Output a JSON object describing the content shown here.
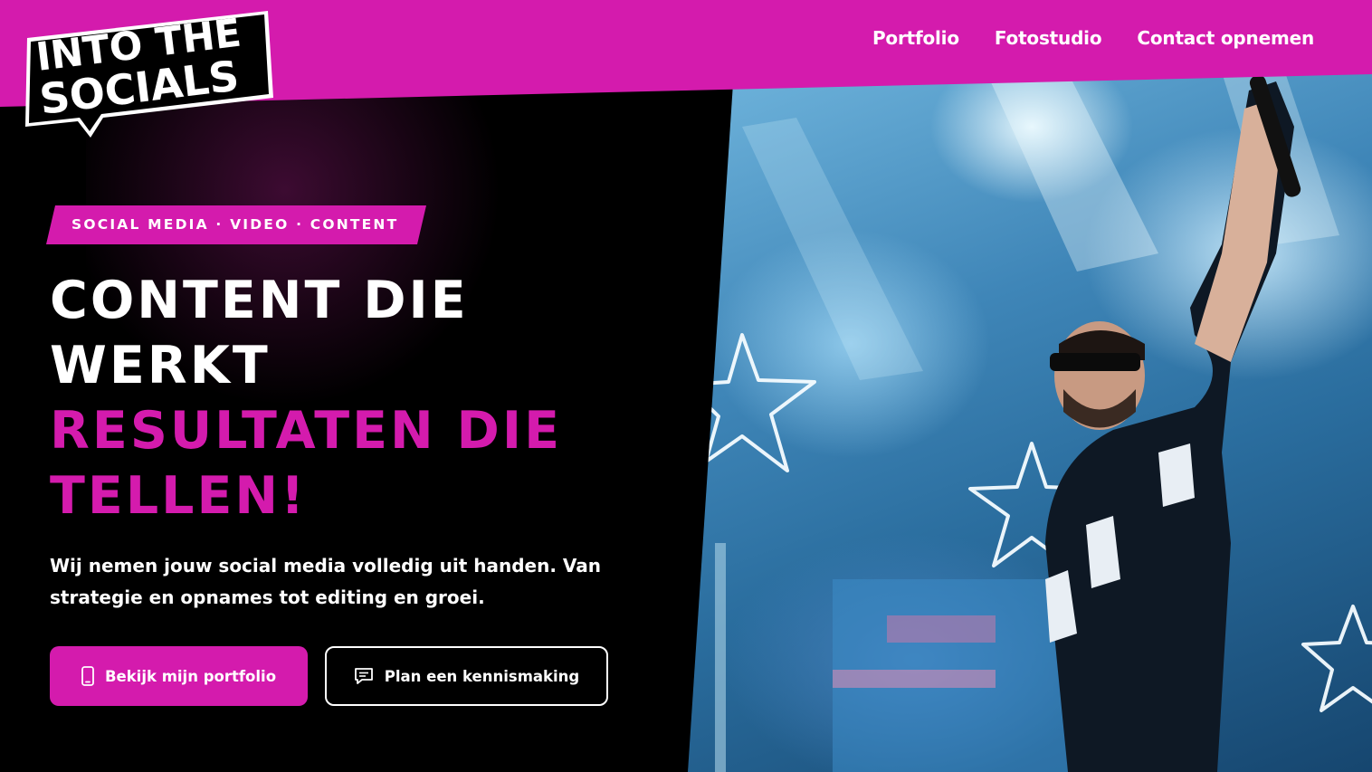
{
  "brand": {
    "logo_line1": "INTO THE",
    "logo_line2": "SOCIALS",
    "accent_color": "#d41bad"
  },
  "nav": {
    "items": [
      {
        "label": "Portfolio"
      },
      {
        "label": "Fotostudio"
      },
      {
        "label": "Contact opnemen"
      }
    ]
  },
  "hero": {
    "tagline": "SOCIAL MEDIA · VIDEO · CONTENT",
    "headline_line1": "CONTENT DIE",
    "headline_line2": "WERKT",
    "headline_line3": "RESULTATEN DIE",
    "headline_line4": "TELLEN!",
    "description": "Wij nemen jouw social media volledig uit handen. Van strategie en opnames tot editing en groei.",
    "primary_button": {
      "label": "Bekijk mijn portfolio",
      "icon": "smartphone-icon"
    },
    "secondary_button": {
      "label": "Plan een kennismaking",
      "icon": "chat-bubble-icon"
    }
  }
}
